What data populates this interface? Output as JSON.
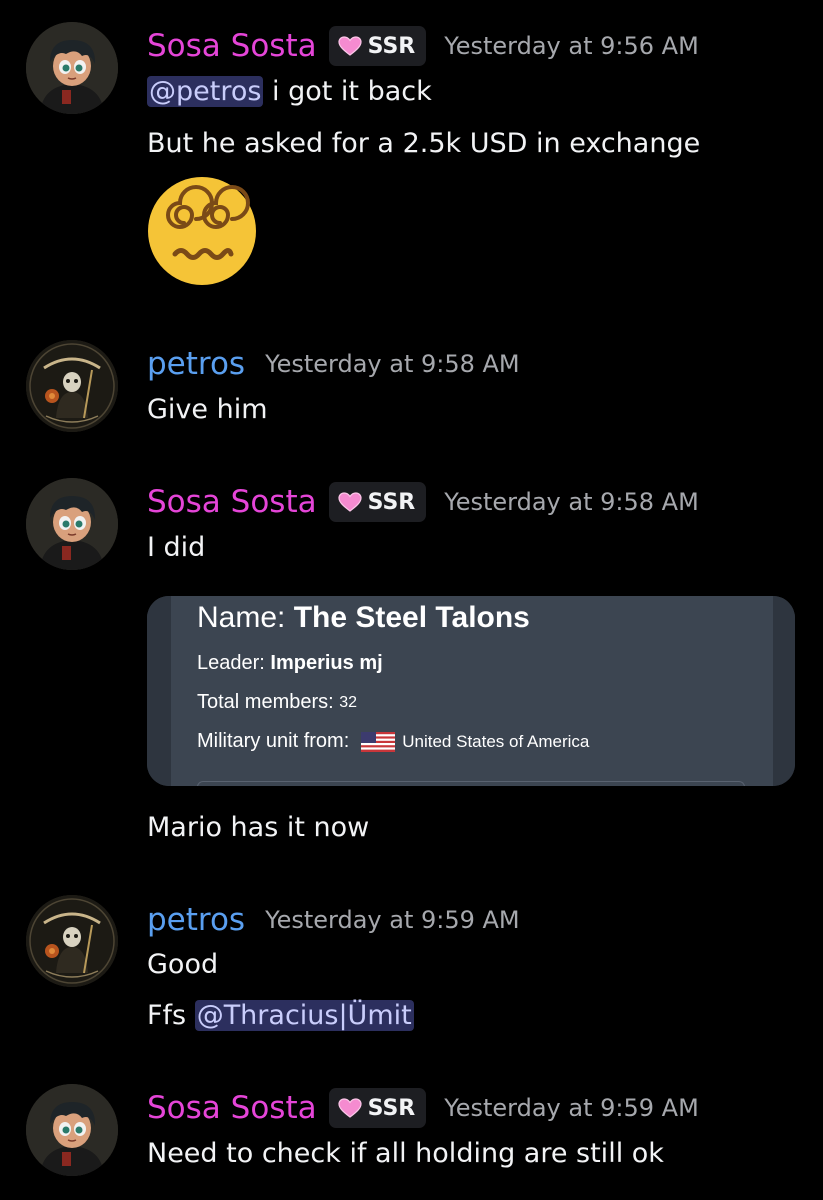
{
  "messages": [
    {
      "author": "Sosa Sosta",
      "tag": "SSR",
      "timestamp": "Yesterday at 9:56 AM",
      "lines": [
        {
          "mention": "@petros",
          "text": " i got it back"
        },
        {
          "text": "But he asked for a 2.5k USD in exchange"
        }
      ],
      "emoji": "dizzy-face-emoji"
    },
    {
      "author": "petros",
      "timestamp": "Yesterday at 9:58 AM",
      "lines": [
        {
          "text": "Give him"
        }
      ]
    },
    {
      "author": "Sosa Sosta",
      "tag": "SSR",
      "timestamp": "Yesterday at 9:58 AM",
      "lines": [
        {
          "text": "I did"
        },
        {
          "text": "Mario has it now"
        }
      ],
      "embed": {
        "name_label": "Name:",
        "name_value": "The Steel Talons",
        "leader_label": "Leader:",
        "leader_value": "Imperius mj",
        "members_label": "Total members:",
        "members_value": "32",
        "unit_label": "Military unit from:",
        "unit_value": "United States of America"
      }
    },
    {
      "author": "petros",
      "timestamp": "Yesterday at 9:59 AM",
      "lines": [
        {
          "text": "Good"
        },
        {
          "text": "Ffs ",
          "mention": "@Thracius|Ümit"
        }
      ]
    },
    {
      "author": "Sosa Sosta",
      "tag": "SSR",
      "timestamp": "Yesterday at 9:59 AM",
      "lines": [
        {
          "text": "Need to check if all holding are still ok"
        }
      ]
    }
  ],
  "colors": {
    "sosa_name": "#e545d8",
    "petros_name": "#5a9ff0",
    "mention_bg": "#2c2f5e",
    "embed_bg": "#3c4551"
  },
  "icons": {
    "sosa_avatar": "cartoon-boy-avatar",
    "petros_avatar": "santa-muerte-avatar",
    "tag_icon": "pink-heart-icon",
    "flag": "us-flag-icon"
  }
}
